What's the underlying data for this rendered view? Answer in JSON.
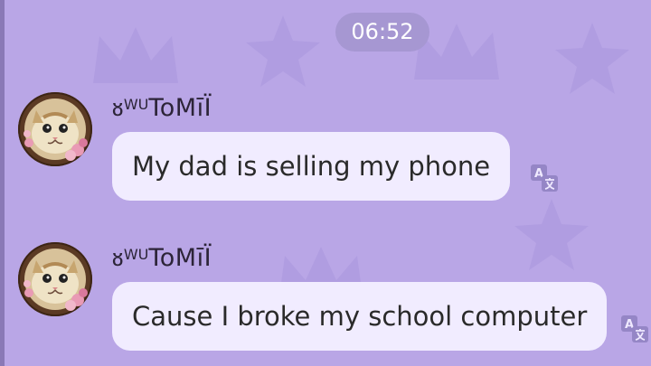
{
  "chat": {
    "time": "06:52",
    "messages": [
      {
        "sender": "ᴕWUToMīÏ",
        "sender_prefix": "ᴕ",
        "sender_sup": "WU",
        "sender_rest": "ToMīÏ",
        "text": "My dad is selling my phone",
        "avatar_icon": "cat-avatar-icon",
        "action_icon": "translate-icon"
      },
      {
        "sender": "ᴕWUToMīÏ",
        "sender_prefix": "ᴕ",
        "sender_sup": "WU",
        "sender_rest": "ToMīÏ",
        "text": "Cause I broke my school computer",
        "avatar_icon": "cat-avatar-icon",
        "action_icon": "translate-icon"
      }
    ]
  },
  "colors": {
    "background": "#b9a6e6",
    "bubble": "#f1ecff",
    "time_pill": "#a697d2",
    "avatar_ring": "#5b3a24"
  }
}
